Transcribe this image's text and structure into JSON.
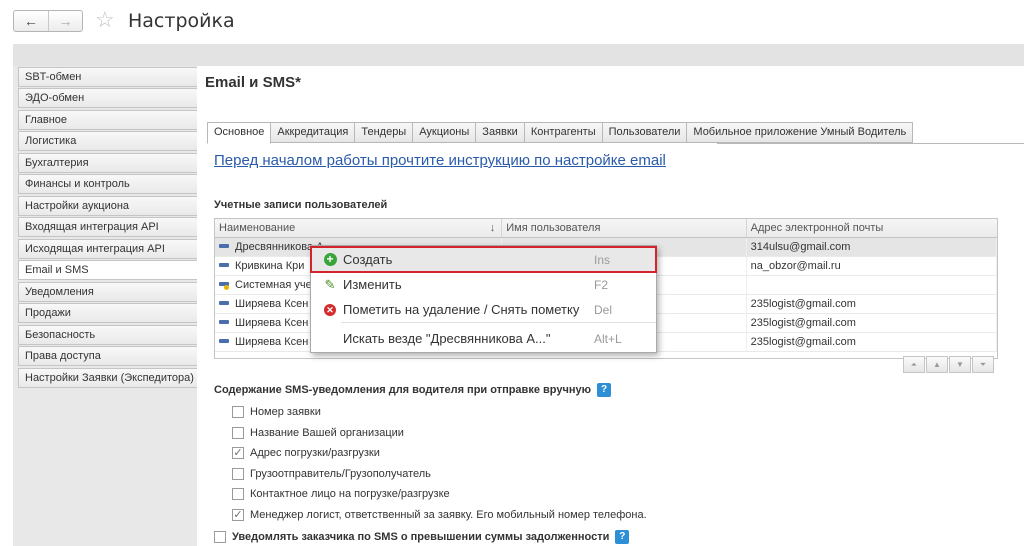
{
  "header": {
    "title": "Настройка",
    "back_glyph": "←",
    "forward_glyph": "→",
    "star_glyph": "☆"
  },
  "sidebar": {
    "items": [
      {
        "label": "SBT-обмен"
      },
      {
        "label": "ЭДО-обмен"
      },
      {
        "label": "Главное"
      },
      {
        "label": "Логистика"
      },
      {
        "label": "Бухгалтерия"
      },
      {
        "label": "Финансы и контроль"
      },
      {
        "label": "Настройки аукциона"
      },
      {
        "label": "Входящая интеграция API"
      },
      {
        "label": "Исходящая интеграция API"
      },
      {
        "label": "Email и SMS"
      },
      {
        "label": "Уведомления"
      },
      {
        "label": "Продажи"
      },
      {
        "label": "Безопасность"
      },
      {
        "label": "Права доступа"
      },
      {
        "label": "Настройки Заявки (Экспедитора)"
      }
    ],
    "active_index": 9
  },
  "main": {
    "section_title": "Email и SMS*",
    "tabs": [
      {
        "label": "Основное"
      },
      {
        "label": "Аккредитация"
      },
      {
        "label": "Тендеры"
      },
      {
        "label": "Аукционы"
      },
      {
        "label": "Заявки"
      },
      {
        "label": "Контрагенты"
      },
      {
        "label": "Пользователи"
      },
      {
        "label": "Мобильное приложение Умный Водитель"
      }
    ],
    "instruction_link": "Перед началом работы прочтите инструкцию по настройке email",
    "accounts_label": "Учетные записи пользователей",
    "table": {
      "columns": [
        "Наименование",
        "Имя пользователя",
        "Адрес электронной почты"
      ],
      "sort_glyph": "↓",
      "rows": [
        {
          "name": "Дресвянникова А",
          "user": "",
          "email": "314ulsu@gmail.com"
        },
        {
          "name": "Кривкина Кри",
          "user": "",
          "email": "na_obzor@mail.ru"
        },
        {
          "name": "Системная уче",
          "user": "",
          "email": ""
        },
        {
          "name": "Ширяева Ксен",
          "user": "",
          "email": "235logist@gmail.com"
        },
        {
          "name": "Ширяева Ксен",
          "user": "",
          "email": "235logist@gmail.com"
        },
        {
          "name": "Ширяева Ксен",
          "user": "",
          "email": "235logist@gmail.com"
        }
      ]
    },
    "scroll_buttons": [
      "⏶",
      "▲",
      "▼",
      "⏷"
    ],
    "sms_title": "Содержание SMS-уведомления для водителя при отправке вручную",
    "help_glyph": "?",
    "sms_options": [
      {
        "label": "Номер заявки",
        "checked": false
      },
      {
        "label": "Название Вашей организации",
        "checked": false
      },
      {
        "label": "Адрес погрузки/разгрузки",
        "checked": true
      },
      {
        "label": "Грузоотправитель/Грузополучатель",
        "checked": false
      },
      {
        "label": "Контактное лицо на погрузке/разгрузке",
        "checked": false
      },
      {
        "label": "Менеджер логист, ответственный за заявку. Его мобильный номер телефона.",
        "checked": true
      }
    ],
    "notify_debt_label": "Уведомлять заказчика по SMS о превышении суммы задолженности"
  },
  "context_menu": {
    "items": [
      {
        "label": "Создать",
        "shortcut": "Ins",
        "icon": "plus-icon"
      },
      {
        "label": "Изменить",
        "shortcut": "F2",
        "icon": "pencil-icon"
      },
      {
        "label": "Пометить на удаление / Снять пометку",
        "shortcut": "Del",
        "icon": "delete-mark-icon"
      },
      {
        "label": "Искать везде \"Дресвянникова А...\"",
        "shortcut": "Alt+L",
        "icon": ""
      }
    ],
    "highlight_color": "#d3232c"
  }
}
